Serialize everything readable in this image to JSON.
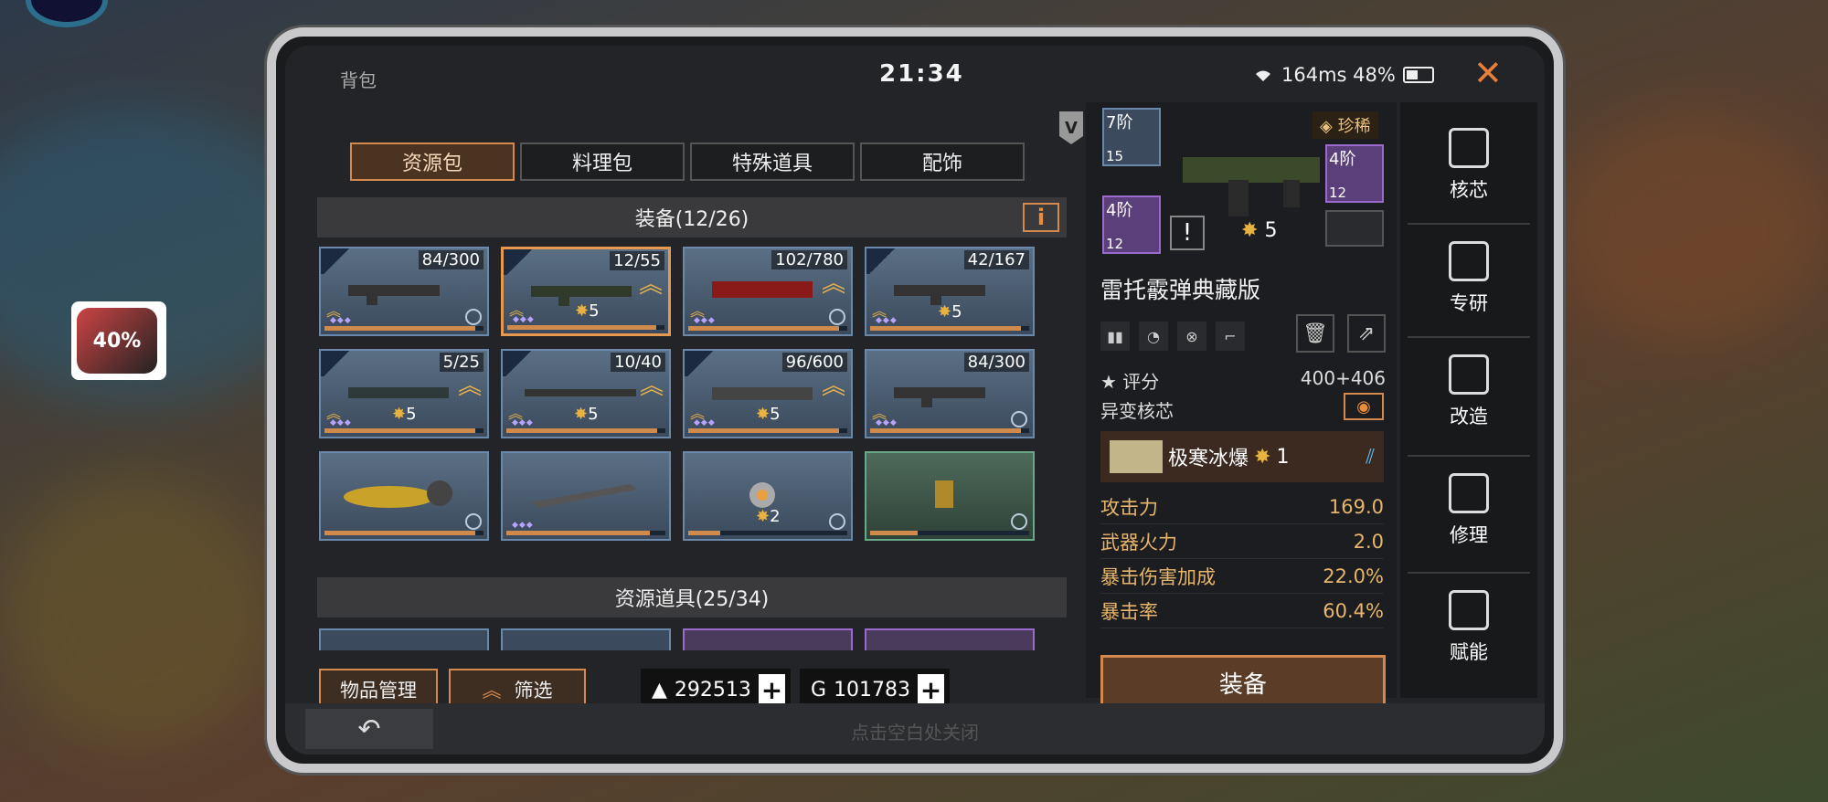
{
  "overlay": {
    "float_percent": "40%"
  },
  "header": {
    "title": "背包",
    "clock": "21:34",
    "status": "164ms 48%"
  },
  "tabs": [
    {
      "label": "资源包",
      "active": true
    },
    {
      "label": "料理包",
      "active": false
    },
    {
      "label": "特殊道具",
      "active": false
    },
    {
      "label": "配饰",
      "active": false
    }
  ],
  "sections": {
    "equipment": "装备(12/26)",
    "resources": "资源道具(25/34)",
    "info_icon": "i"
  },
  "grid": [
    {
      "count": "84/300",
      "stars": "",
      "fill": 0.95
    },
    {
      "count": "12/55",
      "stars": "5",
      "fill": 0.95
    },
    {
      "count": "102/780",
      "stars": "",
      "fill": 0.95
    },
    {
      "count": "42/167",
      "stars": "5",
      "fill": 0.95
    },
    {
      "count": "5/25",
      "stars": "5",
      "fill": 0.95
    },
    {
      "count": "10/40",
      "stars": "5",
      "fill": 0.95
    },
    {
      "count": "96/600",
      "stars": "5",
      "fill": 0.95
    },
    {
      "count": "84/300",
      "stars": "",
      "fill": 0.95
    },
    {
      "count": "",
      "stars": "",
      "fill": 0.95
    },
    {
      "count": "",
      "stars": "",
      "fill": 0.9
    },
    {
      "count": "",
      "stars": "2",
      "fill": 0.2
    },
    {
      "count": "",
      "stars": "",
      "fill": 0.3
    }
  ],
  "bottom": {
    "manage_label": "物品管理",
    "filter_label": "筛选",
    "currency1": "292513",
    "currency2": "101783"
  },
  "footer": {
    "hint": "点击空白处关闭"
  },
  "detail": {
    "mods": [
      {
        "level": "7阶",
        "num": "15"
      },
      {
        "level": "4阶",
        "num": "12"
      },
      {
        "level": "4阶",
        "num": "12"
      }
    ],
    "rarity": "珍稀",
    "star_level": "5",
    "weapon_name": "雷托霰弹典藏版",
    "score_label": "评分",
    "score_value": "400+406",
    "core_label": "异变核芯",
    "core_name": "极寒冰爆",
    "core_level": "1",
    "stats": [
      {
        "label": "攻击力",
        "value": "169.0"
      },
      {
        "label": "武器火力",
        "value": "2.0"
      },
      {
        "label": "暴击伤害加成",
        "value": "22.0%"
      },
      {
        "label": "暴击率",
        "value": "60.4%"
      }
    ],
    "equip_label": "装备"
  },
  "side_nav": [
    {
      "label": "核芯"
    },
    {
      "label": "专研"
    },
    {
      "label": "改造"
    },
    {
      "label": "修理"
    },
    {
      "label": "赋能"
    }
  ]
}
